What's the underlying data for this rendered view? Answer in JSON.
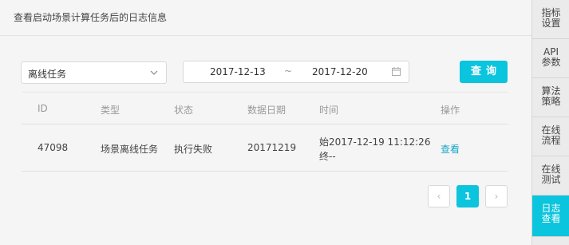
{
  "header": {
    "title": "查看启动场景计算任务后的日志信息"
  },
  "filters": {
    "task_type": "离线任务",
    "date_from": "2017-12-13",
    "date_sep": "~",
    "date_to": "2017-12-20",
    "query_label": "查询"
  },
  "table": {
    "columns": [
      "ID",
      "类型",
      "状态",
      "数据日期",
      "时间",
      "操作"
    ],
    "rows": [
      {
        "id": "47098",
        "type": "场景离线任务",
        "status": "执行失败",
        "data_date": "20171219",
        "time_start": "始2017-12-19 11:12:26",
        "time_end": "终--",
        "action": "查看"
      }
    ]
  },
  "pagination": {
    "prev": "‹",
    "current": "1",
    "next": "›"
  },
  "sidebar": {
    "items": [
      {
        "l1": "指标",
        "l2": "设置"
      },
      {
        "l1": "API",
        "l2": "参数"
      },
      {
        "l1": "算法",
        "l2": "策略"
      },
      {
        "l1": "在线",
        "l2": "流程"
      },
      {
        "l1": "在线",
        "l2": "测试"
      },
      {
        "l1": "日志",
        "l2": "查看"
      }
    ],
    "active_index": 5
  },
  "colors": {
    "accent": "#0bc4dd",
    "link": "#1aa7c8"
  }
}
